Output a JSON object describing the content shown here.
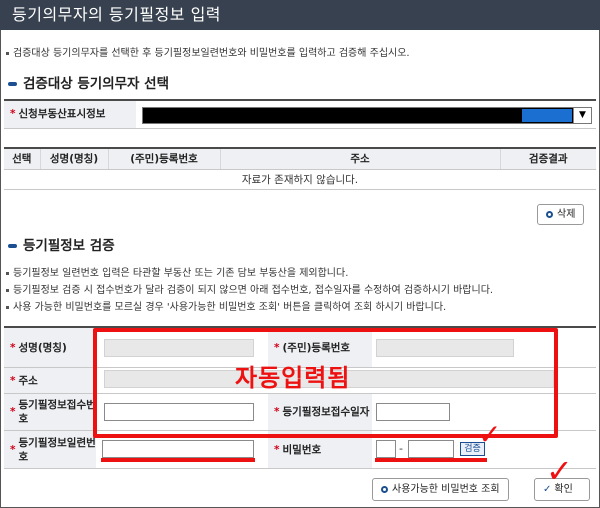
{
  "title": "등기의무자의 등기필정보 입력",
  "intro_note": "검증대상 등기의무자를 선택한 후 등기필정보일련번호와 비밀번호를 입력하고 검증해 주십시오.",
  "section1": {
    "title": "검증대상 등기의무자 선택",
    "select_label": "신청부동산표시정보"
  },
  "grid": {
    "headers": [
      "선택",
      "성명(명칭)",
      "(주민)등록번호",
      "주소",
      "검증결과"
    ],
    "empty_message": "자료가 존재하지 않습니다."
  },
  "delete_button": "삭제",
  "section2": {
    "title": "등기필정보 검증",
    "notes": [
      "등기필정보 일련번호 입력은 타관할 부동산 또는 기존 담보 부동산을 제외합니다.",
      "등기필정보 검증 시 접수번호가 달라 검증이 되지 않으면 아래 접수번호, 접수일자를 수정하여 검증하시기 바랍니다.",
      "사용 가능한 비밀번호를 모르실 경우 '사용가능한 비밀번호 조회' 버튼을 클릭하여 조회 하시기 바랍니다."
    ]
  },
  "form": {
    "name_label": "성명(명칭)",
    "regno_label": "(주민)등록번호",
    "address_label": "주소",
    "receipt_no_label": "등기필정보접수번호",
    "receipt_date_label": "등기필정보접수일자",
    "serial_label": "등기필정보일련번호",
    "password_label": "비밀번호",
    "password_sep": "-",
    "verify_button": "검증"
  },
  "annotation": "자동입력됨",
  "pw_lookup_button": "사용가능한 비밀번호 조회",
  "confirm_button": "확인",
  "colors": {
    "titlebar": "#37414f",
    "accent": "#1b4f91",
    "annotation": "#ee1111"
  }
}
